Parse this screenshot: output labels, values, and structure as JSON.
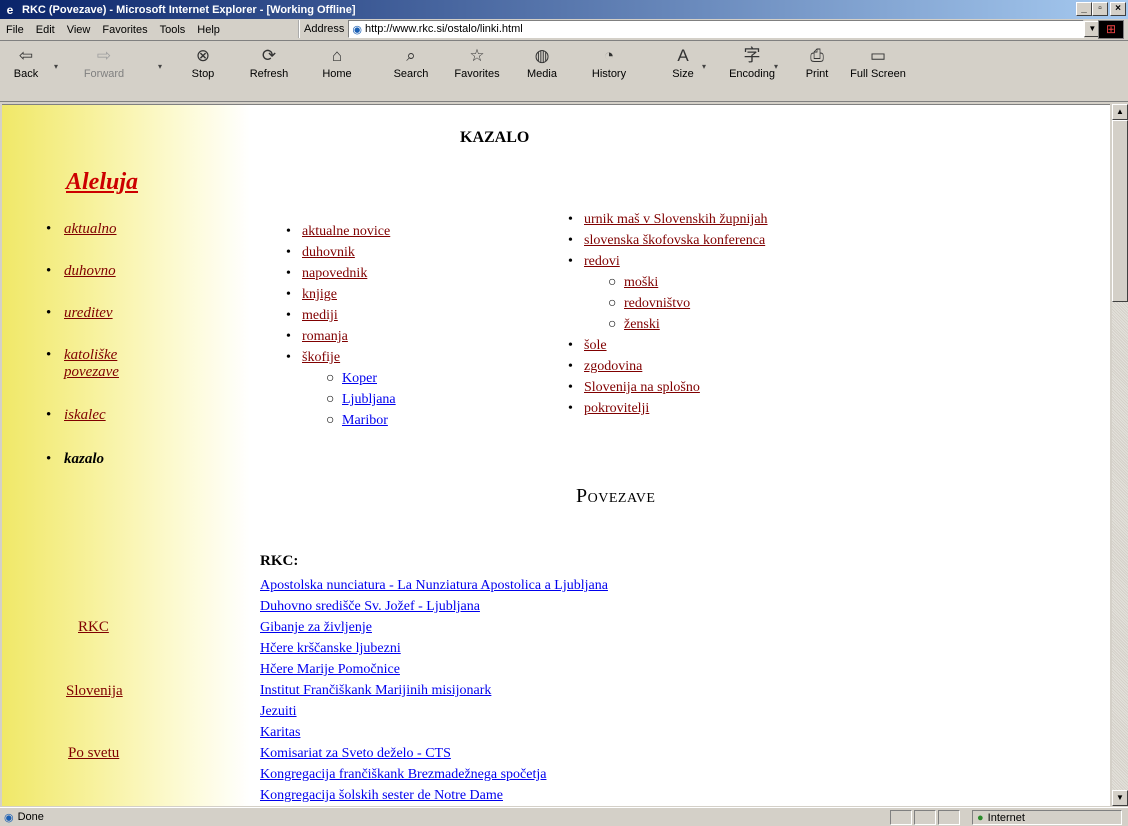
{
  "window": {
    "title": "RKC (Povezave) - Microsoft Internet Explorer - [Working Offline]",
    "icon": "ie-icon",
    "controls": [
      "minimize",
      "maximize",
      "close"
    ]
  },
  "menu": [
    {
      "label": "File"
    },
    {
      "label": "Edit"
    },
    {
      "label": "View"
    },
    {
      "label": "Favorites"
    },
    {
      "label": "Tools"
    },
    {
      "label": "Help"
    }
  ],
  "address": {
    "label": "Address",
    "url": "http://www.rkc.si/ostalo/linki.html"
  },
  "toolbar": [
    {
      "label": "Back",
      "icon": "back-arrow-icon",
      "enabled": true
    },
    {
      "label": "Forward",
      "icon": "forward-arrow-icon",
      "enabled": false
    },
    {
      "label": "Stop",
      "icon": "stop-icon",
      "enabled": true
    },
    {
      "label": "Refresh",
      "icon": "refresh-icon",
      "enabled": true
    },
    {
      "label": "Home",
      "icon": "home-icon",
      "enabled": true
    },
    {
      "label": "Search",
      "icon": "search-icon",
      "enabled": true
    },
    {
      "label": "Favorites",
      "icon": "favorites-icon",
      "enabled": true
    },
    {
      "label": "Media",
      "icon": "media-icon",
      "enabled": true
    },
    {
      "label": "History",
      "icon": "history-icon",
      "enabled": true
    },
    {
      "label": "Size",
      "icon": "text-size-icon",
      "enabled": true
    },
    {
      "label": "Encoding",
      "icon": "encoding-icon",
      "enabled": true
    },
    {
      "label": "Print",
      "icon": "print-icon",
      "enabled": true
    },
    {
      "label": "Full Screen",
      "icon": "fullscreen-icon",
      "enabled": true
    }
  ],
  "sidebar": {
    "brand": "Aleluja",
    "items": [
      {
        "label": "aktualno"
      },
      {
        "label": "duhovno"
      },
      {
        "label": "ureditev"
      },
      {
        "label": "katoliške",
        "label2": "povezave"
      },
      {
        "label": "iskalec"
      },
      {
        "label": "kazalo",
        "current": true
      }
    ],
    "bottom_links": [
      {
        "label": "RKC"
      },
      {
        "label": "Slovenija"
      },
      {
        "label": "Po svetu"
      }
    ]
  },
  "kazalo": {
    "title": "KAZALO",
    "left_list": [
      {
        "label": "aktualne novice",
        "level": 1
      },
      {
        "label": "duhovnik",
        "level": 1
      },
      {
        "label": "napovednik",
        "level": 1
      },
      {
        "label": "knjige",
        "level": 1
      },
      {
        "label": "mediji",
        "level": 1
      },
      {
        "label": "romanja",
        "level": 1
      },
      {
        "label": "škofije",
        "level": 1
      },
      {
        "label": "Koper",
        "level": 2
      },
      {
        "label": "Ljubljana",
        "level": 2
      },
      {
        "label": "Maribor",
        "level": 2
      }
    ],
    "right_list": [
      {
        "label": "urnik maš v Slovenskih župnijah",
        "level": 1
      },
      {
        "label": "slovenska škofovska konferenca",
        "level": 1
      },
      {
        "label": "redovi",
        "level": 1
      },
      {
        "label": "moški",
        "level": 2
      },
      {
        "label": "redovništvo",
        "level": 2
      },
      {
        "label": "ženski",
        "level": 2
      },
      {
        "label": "šole",
        "level": 1
      },
      {
        "label": "zgodovina",
        "level": 1
      },
      {
        "label": "Slovenija na splošno",
        "level": 1
      },
      {
        "label": "pokrovitelji",
        "level": 1
      }
    ]
  },
  "povezave": {
    "title": "Povezave",
    "section_label": "RKC:",
    "links": [
      "Apostolska nunciatura - La Nunziatura Apostolica a Ljubljana",
      "Duhovno središče Sv. Jožef - Ljubljana",
      "Gibanje za življenje",
      "Hčere krščanske ljubezni",
      "Hčere Marije Pomočnice",
      "Institut Frančiškank Marijinih misijonark",
      "Jezuiti",
      "Karitas",
      "Komisariat za Sveto deželo - CTS",
      "Kongregacija frančiškank Brezmadežnega spočetja",
      "Kongregacija šolskih sester de Notre Dame"
    ]
  },
  "status": {
    "text": "Done",
    "zone": "Internet"
  },
  "colors": {
    "visited_link": "#800000",
    "link": "#0000ee",
    "brand": "#cc0000",
    "sidebar_gradient_start": "#f0e868"
  }
}
